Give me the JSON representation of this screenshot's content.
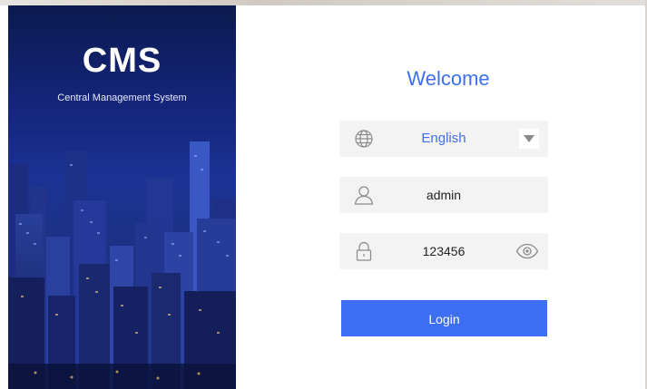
{
  "hero": {
    "title": "CMS",
    "subtitle": "Central Management System"
  },
  "login": {
    "welcome": "Welcome",
    "language": {
      "selected": "English",
      "icon": "globe-icon",
      "dropdown_icon": "caret-down-icon"
    },
    "username": {
      "value": "admin",
      "icon": "user-icon"
    },
    "password": {
      "value": "123456",
      "icon": "lock-icon",
      "toggle_icon": "eye-icon"
    },
    "submit_label": "Login"
  },
  "colors": {
    "accent": "#3d6ff0",
    "button": "#3d6ff5",
    "field_bg": "#f3f3f3",
    "hero_bg": "#14257a"
  }
}
